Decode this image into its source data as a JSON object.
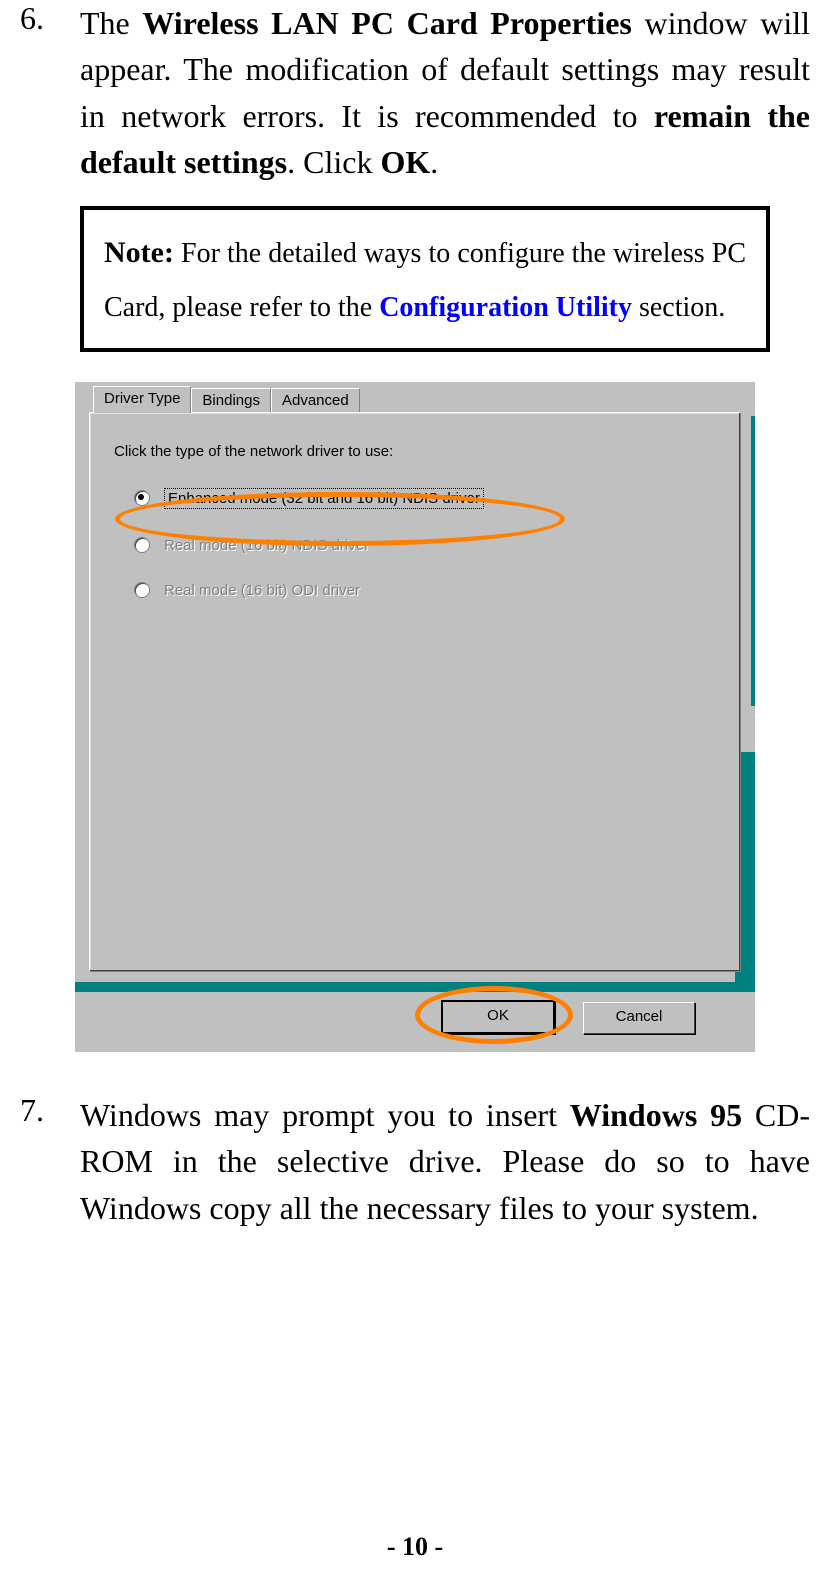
{
  "step6": {
    "number": "6.",
    "part1": "The ",
    "bold1": "Wireless LAN PC Card Properties",
    "part2": " window will appear.  The modification of default settings may result in network errors.  It is recommended to ",
    "bold2": "remain the default settings",
    "part3": ".    Click ",
    "bold3": "OK",
    "part4": "."
  },
  "note": {
    "label": "Note:",
    "part1": " For the detailed ways to configure the wireless PC Card, please refer to the ",
    "link": "Configuration Utility",
    "part2": " section."
  },
  "dialog": {
    "tabs": [
      "Driver Type",
      "Bindings",
      "Advanced"
    ],
    "instruction": "Click the type of the network driver to use:",
    "options": [
      {
        "label": "Enhanced mode (32 bit and 16 bit) NDIS driver",
        "selected": true,
        "disabled": false
      },
      {
        "label": "Real mode (16 bit) NDIS driver",
        "selected": false,
        "disabled": true
      },
      {
        "label": "Real mode (16 bit) ODI driver",
        "selected": false,
        "disabled": true
      }
    ],
    "ok": "OK",
    "cancel": "Cancel"
  },
  "step7": {
    "number": "7.",
    "part1": "Windows may prompt you to insert ",
    "bold1": "Windows 95",
    "part2": " CD-ROM in the selective drive.  Please do so to have Windows copy all the necessary files to your system."
  },
  "footer": "- 10 -"
}
